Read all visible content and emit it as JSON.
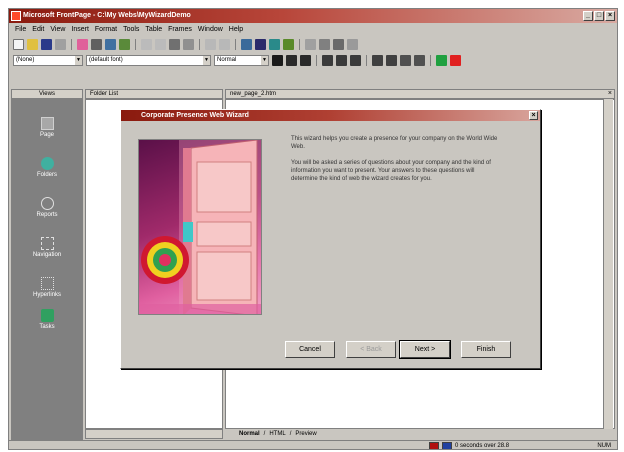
{
  "window": {
    "title": "Microsoft FrontPage - C:\\My Webs\\MyWizardDemo",
    "controls": [
      "_",
      "□",
      "×"
    ]
  },
  "menubar": [
    "File",
    "Edit",
    "View",
    "Insert",
    "Format",
    "Tools",
    "Table",
    "Frames",
    "Window",
    "Help"
  ],
  "formatting": {
    "style_value": "(None)",
    "font_value": "(default font)",
    "size_value": "Normal"
  },
  "views": {
    "header": "Views",
    "items": [
      {
        "label": "Page",
        "icon": "page-icon"
      },
      {
        "label": "Folders",
        "icon": "folder-icon"
      },
      {
        "label": "Reports",
        "icon": "reports-icon"
      },
      {
        "label": "Navigation",
        "icon": "navigation-icon"
      },
      {
        "label": "Hyperlinks",
        "icon": "hyperlinks-icon"
      },
      {
        "label": "Tasks",
        "icon": "tasks-icon"
      }
    ]
  },
  "folder_list": {
    "header": "Folder List"
  },
  "page": {
    "header": "new_page_2.htm"
  },
  "page_tabs": [
    "Normal",
    "HTML",
    "Preview"
  ],
  "status": {
    "modem_text": "0 seconds over 28.8",
    "cap": "NUM"
  },
  "wizard": {
    "title": "Corporate Presence Web Wizard",
    "close": "×",
    "paragraphs": [
      "This wizard helps you create a presence for your company on the World Wide Web.",
      "You will be asked a series of questions about your company and the kind of information you want to present. Your answers to these questions will determine the kind of web the wizard creates for you."
    ],
    "buttons": {
      "cancel": "Cancel",
      "back": "< Back",
      "next": "Next >",
      "finish": "Finish"
    }
  }
}
